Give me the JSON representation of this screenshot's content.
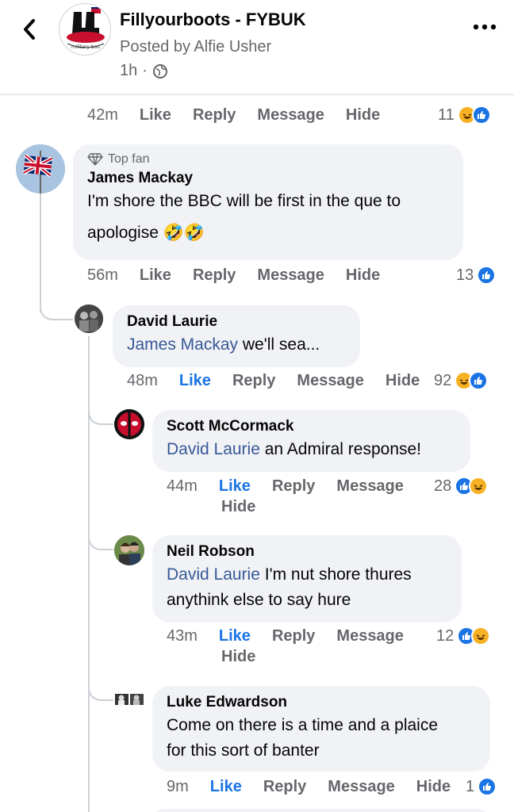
{
  "header": {
    "page_name": "Fillyourboots - FYBUK",
    "posted_by": "Posted by Alfie Usher",
    "time": "1h",
    "separator": "·",
    "logo_text": "military boo"
  },
  "previous_comment": {
    "time": "42m",
    "actions": [
      "Like",
      "Reply",
      "Message",
      "Hide"
    ],
    "reaction_count": "11",
    "reactions": [
      "haha",
      "like"
    ]
  },
  "comments": [
    {
      "badge": "Top fan",
      "author": "James Mackay",
      "text_line1": "I'm shore the BBC will be first in the que to",
      "text_line2": "apologise 🤣🤣",
      "time": "56m",
      "actions": [
        "Like",
        "Reply",
        "Message",
        "Hide"
      ],
      "reaction_count": "13",
      "reactions": [
        "like"
      ]
    },
    {
      "author": "David Laurie",
      "mention": "James Mackay",
      "text": " we'll sea...",
      "time": "48m",
      "actions": [
        "Like",
        "Reply",
        "Message",
        "Hide"
      ],
      "liked": true,
      "reaction_count": "92",
      "reactions": [
        "haha",
        "like"
      ]
    },
    {
      "author": "Scott McCormack",
      "mention": "David Laurie",
      "text": " an Admiral response!",
      "time": "44m",
      "actions": [
        "Like",
        "Reply",
        "Message",
        "Hide"
      ],
      "liked": true,
      "reaction_count": "28",
      "reactions": [
        "like",
        "haha"
      ]
    },
    {
      "author": "Neil Robson",
      "mention": "David Laurie",
      "text_line1": " I'm nut shore thures",
      "text_line2": "anythink else to say hure",
      "time": "43m",
      "actions": [
        "Like",
        "Reply",
        "Message",
        "Hide"
      ],
      "liked": true,
      "reaction_count": "12",
      "reactions": [
        "like",
        "haha"
      ]
    },
    {
      "author": "Luke Edwardson",
      "text_line1": "Come on there is a time and a plaice",
      "text_line2": "for this sort of banter",
      "time": "9m",
      "actions": [
        "Like",
        "Reply",
        "Message",
        "Hide"
      ],
      "liked": true,
      "reaction_count": "1",
      "reactions": [
        "like"
      ]
    }
  ],
  "colors": {
    "like_blue": "#1b74e4",
    "bubble_gray": "#f0f2f5",
    "meta_gray": "#65676b",
    "mention_blue": "#385898"
  }
}
